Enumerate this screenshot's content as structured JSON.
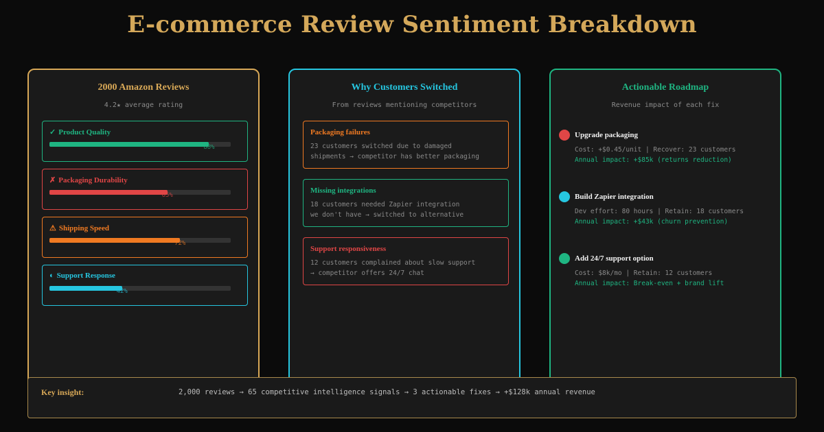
{
  "title": "E-commerce Review Sentiment Breakdown",
  "reviews": {
    "title": "2000 Amazon Reviews",
    "subtitle": "4.2★ average rating",
    "metrics": [
      {
        "icon": "✓",
        "label": "Product Quality",
        "value_text": "88%",
        "value": 0.88,
        "color": "#1fb582"
      },
      {
        "icon": "✗",
        "label": "Packaging Durability",
        "value_text": "65%",
        "value": 0.65,
        "color": "#e04646"
      },
      {
        "icon": "⚠",
        "label": "Shipping Speed",
        "value_text": "72%",
        "value": 0.72,
        "color": "#f07a22"
      },
      {
        "icon": "◐",
        "label": "Support Response",
        "value_text": "42%",
        "value": 0.4,
        "color": "#26c6e0"
      }
    ]
  },
  "switched": {
    "title": "Why Customers Switched",
    "subtitle": "From reviews mentioning competitors",
    "reasons": [
      {
        "title": "Packaging failures",
        "line1": "23 customers switched due to damaged",
        "line2": "shipments → competitor has better packaging",
        "color": "#f07a22"
      },
      {
        "title": "Missing integrations",
        "line1": "18 customers needed Zapier integration",
        "line2": "we don't have → switched to alternative",
        "color": "#1fb582"
      },
      {
        "title": "Support responsiveness",
        "line1": "12 customers complained about slow support",
        "line2": "→ competitor offers 24/7 chat",
        "color": "#e04646"
      }
    ]
  },
  "roadmap": {
    "title": "Actionable Roadmap",
    "subtitle": "Revenue impact of each fix",
    "steps": [
      {
        "title": "Upgrade packaging",
        "detail": "Cost: +$0.45/unit | Recover: 23 customers",
        "impact": "Annual impact: +$85k (returns reduction)",
        "color": "#e04646"
      },
      {
        "title": "Build Zapier integration",
        "detail": "Dev effort: 80 hours | Retain: 18 customers",
        "impact": "Annual impact: +$43k (churn prevention)",
        "color": "#26c6e0"
      },
      {
        "title": "Add 24/7 support option",
        "detail": "Cost: $8k/mo | Retain: 12 customers",
        "impact": "Annual impact: Break-even + brand lift",
        "color": "#1fb582"
      }
    ]
  },
  "insight": {
    "label": "Key insight:",
    "text": "2,000 reviews → 65 competitive intelligence signals → 3 actionable fixes → +$128k annual revenue"
  }
}
